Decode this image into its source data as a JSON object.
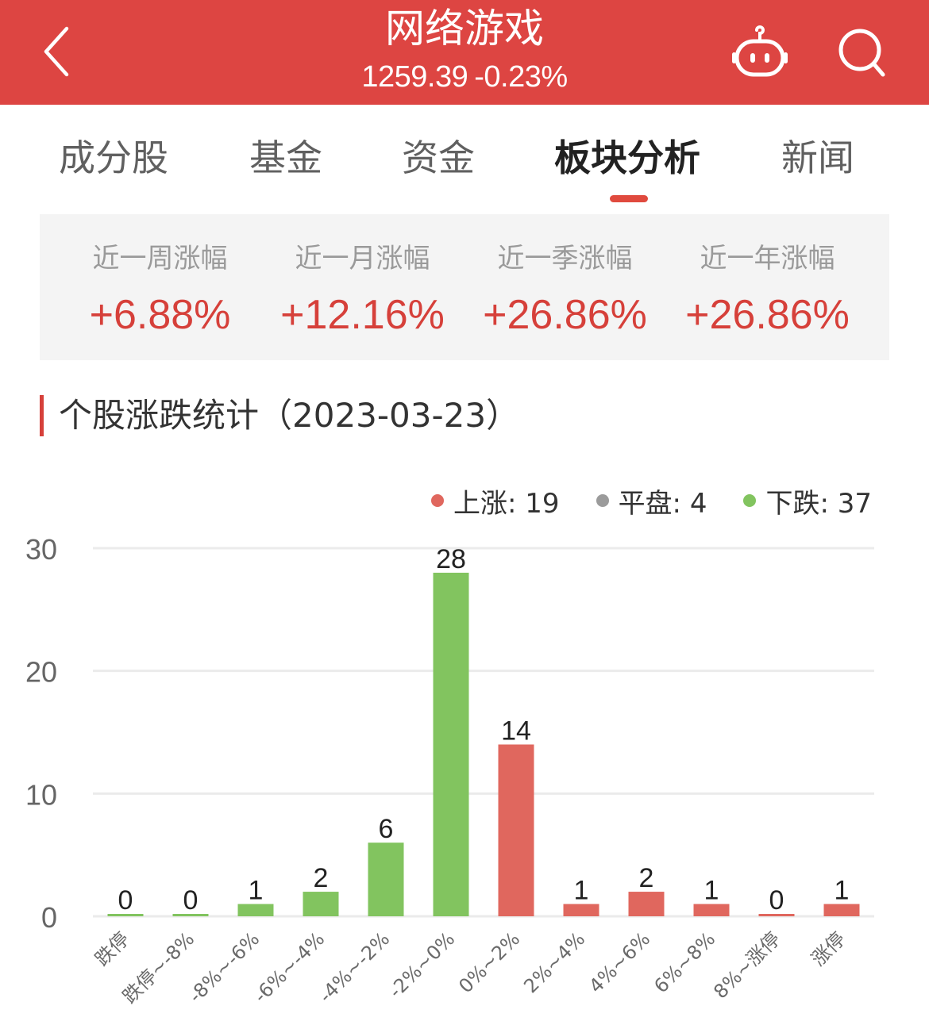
{
  "header": {
    "title": "网络游戏",
    "index_value": "1259.39",
    "index_change": "-0.23%",
    "back_icon": "chevron-left-icon",
    "robot_icon": "robot-assistant-icon",
    "search_icon": "search-icon",
    "brand_color": "#dd4542"
  },
  "tabs": [
    {
      "label": "成分股",
      "active": false
    },
    {
      "label": "基金",
      "active": false
    },
    {
      "label": "资金",
      "active": false
    },
    {
      "label": "板块分析",
      "active": true
    },
    {
      "label": "新闻",
      "active": false
    }
  ],
  "performance": [
    {
      "label": "近一周涨幅",
      "value": "+6.88%"
    },
    {
      "label": "近一月涨幅",
      "value": "+12.16%"
    },
    {
      "label": "近一季涨幅",
      "value": "+26.86%"
    },
    {
      "label": "近一年涨幅",
      "value": "+26.86%"
    }
  ],
  "section": {
    "title": "个股涨跌统计（2023-03-23）"
  },
  "legend": [
    {
      "label": "上涨: 19",
      "color": "#e0675e"
    },
    {
      "label": "平盘: 4",
      "color": "#9b9b9b"
    },
    {
      "label": "下跌: 37",
      "color": "#82c45f"
    }
  ],
  "chart_data": {
    "type": "bar",
    "title": "个股涨跌统计（2023-03-23）",
    "xlabel": "",
    "ylabel": "",
    "categories": [
      "跌停",
      "跌停~-8%",
      "-8%~-6%",
      "-6%~-4%",
      "-4%~-2%",
      "-2%~0%",
      "0%~2%",
      "2%~4%",
      "4%~6%",
      "6%~8%",
      "8%~涨停",
      "涨停"
    ],
    "values": [
      0,
      0,
      1,
      2,
      6,
      28,
      14,
      1,
      2,
      1,
      0,
      1
    ],
    "bar_colors": [
      "#82c45f",
      "#82c45f",
      "#82c45f",
      "#82c45f",
      "#82c45f",
      "#82c45f",
      "#e0675e",
      "#e0675e",
      "#e0675e",
      "#e0675e",
      "#e0675e",
      "#e0675e"
    ],
    "ylim": [
      0,
      30
    ],
    "yticks": [
      0,
      10,
      20,
      30
    ],
    "grid": true,
    "legend_position": "top-right",
    "summary": {
      "up": 19,
      "flat": 4,
      "down": 37
    }
  }
}
